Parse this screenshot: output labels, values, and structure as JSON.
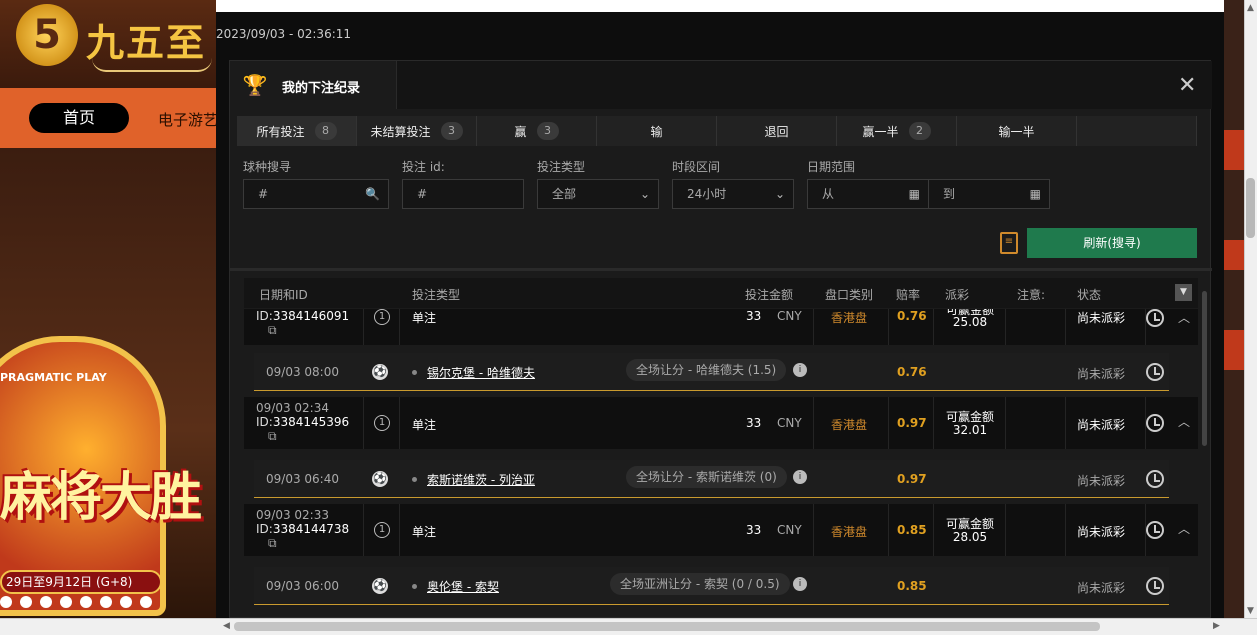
{
  "background": {
    "logo_text": "九五至",
    "nav_home": "首页",
    "nav_games": "电子游艺",
    "promo_brand": "PRAGMATIC PLAY",
    "promo_title": "麻将大胜",
    "promo_date": "29日至9月12日 (G+8)"
  },
  "timestamp": "2023/09/03 - 02:36:11",
  "modal": {
    "title": "我的下注纪录",
    "close": "✕"
  },
  "tabs": [
    {
      "label": "所有投注",
      "count": "8"
    },
    {
      "label": "未结算投注",
      "count": "3"
    },
    {
      "label": "赢",
      "count": "3"
    },
    {
      "label": "输",
      "count": ""
    },
    {
      "label": "退回",
      "count": ""
    },
    {
      "label": "赢一半",
      "count": "2"
    },
    {
      "label": "输一半",
      "count": ""
    },
    {
      "label": "",
      "count": ""
    }
  ],
  "filters": {
    "ball_search": {
      "label": "球种搜寻",
      "value": "#"
    },
    "bet_id": {
      "label": "投注 id:",
      "value": "#"
    },
    "bet_type": {
      "label": "投注类型",
      "value": "全部"
    },
    "period": {
      "label": "时段区间",
      "value": "24小时"
    },
    "date_range": {
      "label": "日期范围",
      "from": "从",
      "to": "到"
    }
  },
  "refresh_label": "刷新(搜寻)",
  "table": {
    "headers": {
      "date_id": "日期和ID",
      "bet_type": "投注类型",
      "amount": "投注金额",
      "market": "盘口类别",
      "odds": "赔率",
      "payout": "派彩",
      "note": "注意:",
      "status": "状态"
    },
    "bets": [
      {
        "date": "",
        "id_prefix": "ID:",
        "id": "3384146091",
        "type": "单注",
        "amount": "33",
        "currency": "CNY",
        "market": "香港盘",
        "odds": "0.76",
        "payout_label": "可赢金额",
        "payout": "25.08",
        "status": "尚未派彩",
        "leg": {
          "datetime": "09/03 08:00",
          "match": "锡尔克堡 - 哈维德夫",
          "selection": "全场让分 - 哈维德夫 (1.5)",
          "odds": "0.76",
          "status": "尚未派彩"
        }
      },
      {
        "date": "09/03 02:34",
        "id_prefix": "ID:",
        "id": "3384145396",
        "type": "单注",
        "amount": "33",
        "currency": "CNY",
        "market": "香港盘",
        "odds": "0.97",
        "payout_label": "可赢金额",
        "payout": "32.01",
        "status": "尚未派彩",
        "leg": {
          "datetime": "09/03 06:40",
          "match": "索斯诺维茨 - 列治亚",
          "selection": "全场让分 - 索斯诺维茨 (0)",
          "odds": "0.97",
          "status": "尚未派彩"
        }
      },
      {
        "date": "09/03 02:33",
        "id_prefix": "ID:",
        "id": "3384144738",
        "type": "单注",
        "amount": "33",
        "currency": "CNY",
        "market": "香港盘",
        "odds": "0.85",
        "payout_label": "可赢金额",
        "payout": "28.05",
        "status": "尚未派彩",
        "leg": {
          "datetime": "09/03 06:00",
          "match": "奥伦堡 - 索契",
          "selection": "全场亚洲让分 - 索契 (0 / 0.5)",
          "odds": "0.85",
          "status": "尚未派彩"
        }
      }
    ]
  },
  "colors": {
    "accent_green": "#1f7a4d",
    "odds_gold": "#e0a020",
    "market_orange": "#d08a2c"
  },
  "icons": [
    "trophy-icon",
    "close-icon",
    "search-icon",
    "chevron-down-icon",
    "calendar-icon",
    "clipboard-icon",
    "clock-icon",
    "soccer-ball-icon",
    "info-icon",
    "copy-icon",
    "chevron-up-icon"
  ]
}
